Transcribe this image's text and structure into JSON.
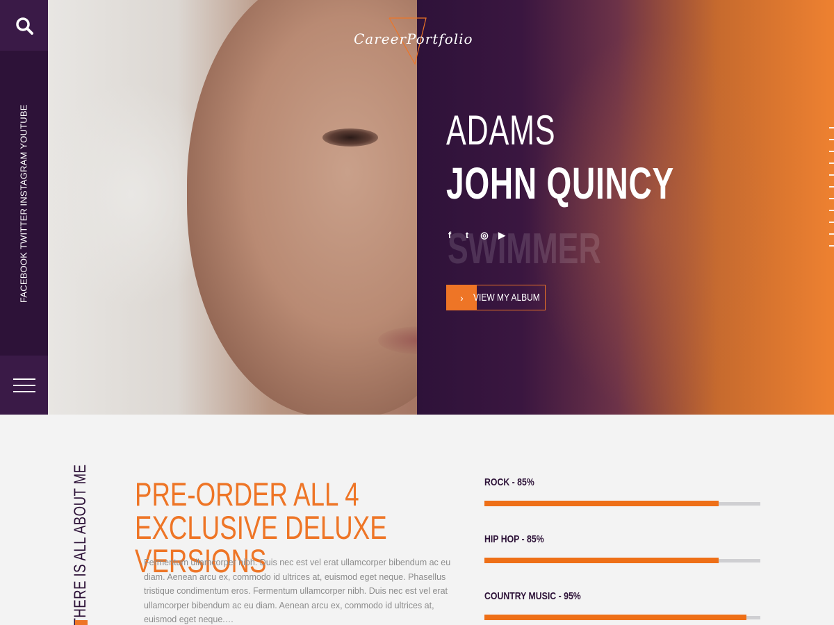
{
  "colors": {
    "purple_dark": "#2d1238",
    "orange_accent": "#ee7526",
    "background": "#f3f3f3"
  },
  "icons": {
    "search": "search-icon",
    "menu": "hamburger-menu-icon",
    "logo": "triangle-logo-icon"
  },
  "sidebar": {
    "links": [
      "YOUTUBE",
      "INSTAGRAM",
      "TWITTER",
      "FACEBOOK"
    ]
  },
  "logo": {
    "text": "CareerPortfolio"
  },
  "hero": {
    "first_name": "ADAMS",
    "last_name": "JOHN QUINCY",
    "profession": "SWIMMER",
    "social_icons": [
      "f",
      "t",
      "◎",
      "▶"
    ],
    "button_label": "VIEW MY ALBUM",
    "button_icon": "›"
  },
  "about": {
    "vertical_title": "THERE IS ALL ABOUT ME",
    "headline": "PRE-ORDER ALL 4 EXCLUSIVE DELUXE VERSIONS",
    "body": "Fermentum ullamcorper nibh. Duis nec est vel erat ullamcorper bibendum ac eu diam. Aenean arcu ex, commodo id ultrices at, euismod eget neque. Phasellus tristique condimentum eros. Fermentum ullamcorper nibh. Duis nec est vel erat ullamcorper bibendum ac eu diam. Aenean arcu ex, commodo id ultrices at, euismod eget neque.…"
  },
  "skills": [
    {
      "label": "ROCK - 85%",
      "percent": 85
    },
    {
      "label": "HIP HOP - 85%",
      "percent": 85
    },
    {
      "label": "COUNTRY MUSIC - 95%",
      "percent": 95
    }
  ]
}
